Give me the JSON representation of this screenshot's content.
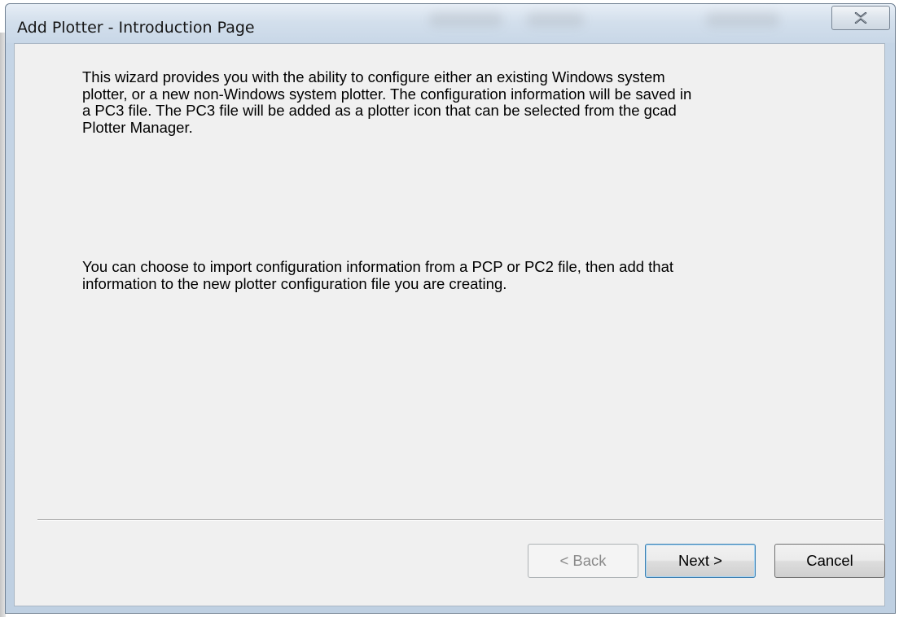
{
  "window": {
    "title": "Add Plotter - Introduction Page",
    "close_icon": "close-icon"
  },
  "content": {
    "paragraph1": "This wizard provides you with the ability to configure either an existing Windows system plotter, or a new non-Windows system plotter. The configuration information will be saved in a PC3 file. The PC3 file will be added as a plotter icon that can be selected from the gcad Plotter Manager.",
    "paragraph2": "You can choose to import configuration information from a PCP or PC2 file, then add that information to the new plotter configuration file you are creating."
  },
  "buttons": {
    "back": "< Back",
    "next": "Next >",
    "cancel": "Cancel"
  },
  "colors": {
    "titlebar": "#d3dfec",
    "client_bg": "#f0f0f0",
    "default_button_border": "#3c7fb1"
  }
}
